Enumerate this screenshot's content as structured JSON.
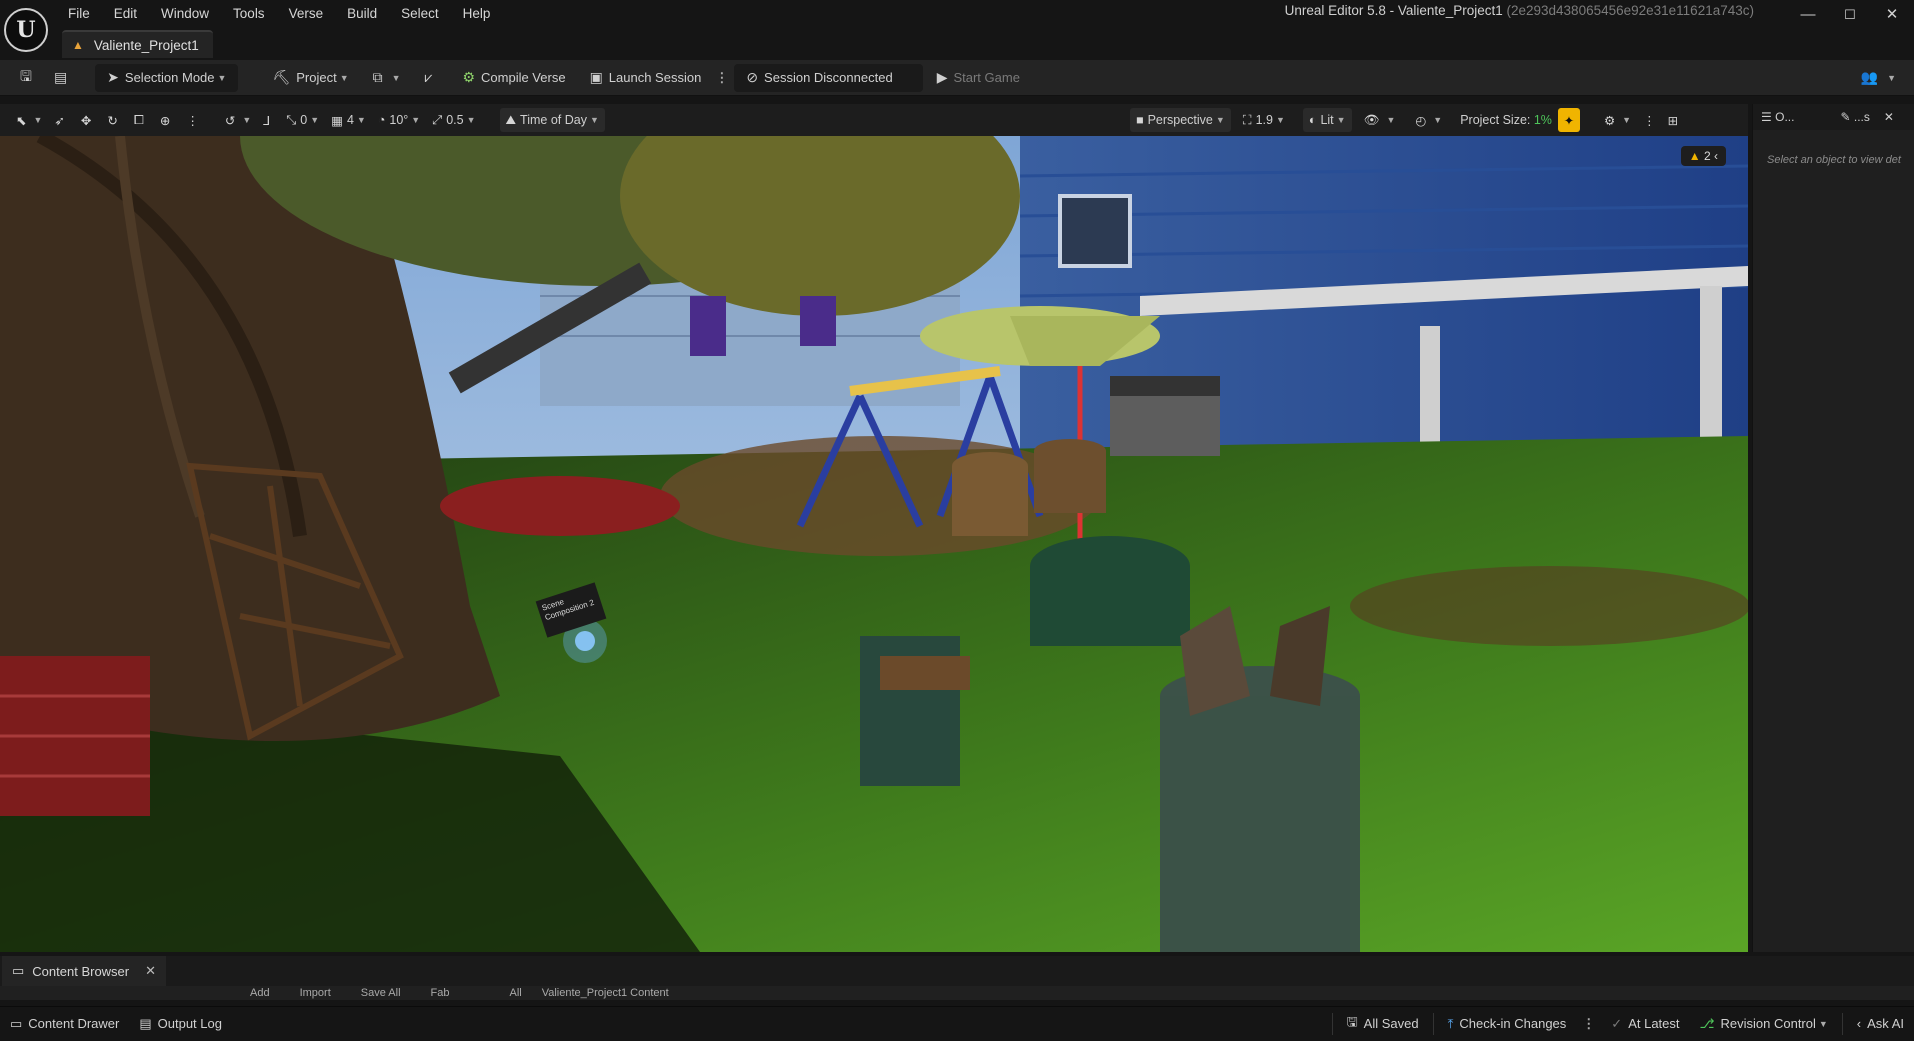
{
  "menu": [
    "File",
    "Edit",
    "Window",
    "Tools",
    "Verse",
    "Build",
    "Select",
    "Help"
  ],
  "window": {
    "title": "Unreal Editor 5.8 - Valiente_Project1",
    "hash": "(2e293d438065456e92e31e11621a743c)",
    "minimize": "—",
    "maximize": "☐",
    "close": "✕"
  },
  "doc_tab": {
    "label": "Valiente_Project1"
  },
  "toolbar": {
    "selection_mode": "Selection Mode",
    "project": "Project",
    "compile_verse": "Compile Verse",
    "launch_session": "Launch Session",
    "session_status": "Session Disconnected",
    "start_game": "Start Game"
  },
  "viewport_toolbar": {
    "rotation_snap": "0",
    "grid_snap": "4",
    "angle_snap": "10°",
    "scale_snap": "0.5",
    "time_of_day": "Time of Day",
    "perspective": "Perspective",
    "camera_speed": "1.9",
    "lit": "Lit",
    "project_size_label": "Project Size:",
    "project_size_value": "1%"
  },
  "viewport": {
    "warnings": "2",
    "scene_label": "Scene Composition 2"
  },
  "right_panel": {
    "tab_outliner": "O...",
    "tab_details": "...s",
    "message": "Select an object to view det"
  },
  "content_browser": {
    "tab": "Content Browser",
    "add": "Add",
    "import": "Import",
    "save_all": "Save All",
    "fab": "Fab",
    "path_all": "All",
    "path_content": "Valiente_Project1 Content"
  },
  "status_bar": {
    "content_drawer": "Content Drawer",
    "output_log": "Output Log",
    "all_saved": "All Saved",
    "check_in": "Check-in Changes",
    "at_latest": "At Latest",
    "revision_control": "Revision Control",
    "ask_ai": "Ask AI"
  },
  "colors": {
    "accent_yellow": "#f0b400",
    "warning": "#e8a33a",
    "snap_blue": "#5aa8f0"
  }
}
